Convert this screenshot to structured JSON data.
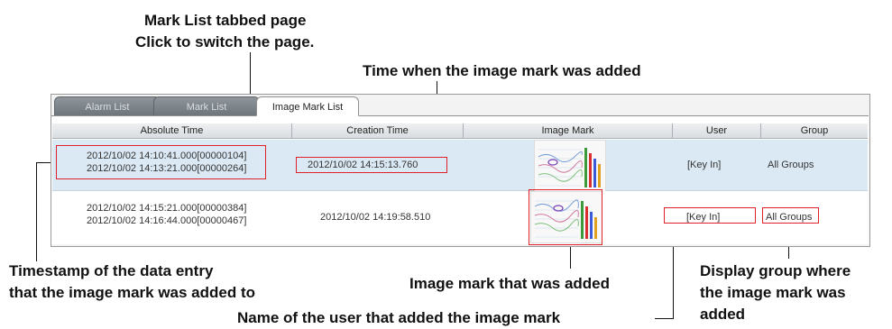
{
  "callouts": {
    "tab_title": "Mark List tabbed page",
    "tab_sub": "Click to switch the page.",
    "creation_time": "Time when the image mark was added",
    "timestamp_line1": "Timestamp of the data entry",
    "timestamp_line2": "that the image mark was added to",
    "image_mark": "Image mark that was added",
    "user": "Name of the user that added the image mark",
    "group_line1": "Display group where",
    "group_line2": "the image mark was",
    "group_line3": "added"
  },
  "tabs": [
    {
      "label": "Alarm List",
      "active": false
    },
    {
      "label": "Mark List",
      "active": false
    },
    {
      "label": "Image Mark List",
      "active": true
    }
  ],
  "table": {
    "headers": [
      "Absolute Time",
      "Creation Time",
      "Image Mark",
      "User",
      "Group"
    ],
    "rows": [
      {
        "absolute_time": [
          "2012/10/02 14:10:41.000[00000104]",
          "2012/10/02 14:13:21.000[00000264]"
        ],
        "creation_time": "2012/10/02 14:15:13.760",
        "user": "[Key In]",
        "group": "All Groups",
        "selected": true
      },
      {
        "absolute_time": [
          "2012/10/02 14:15:21.000[00000384]",
          "2012/10/02 14:16:44.000[00000467]"
        ],
        "creation_time": "2012/10/02 14:19:58.510",
        "user": "[Key In]",
        "group": "All Groups",
        "selected": false
      }
    ]
  },
  "colors": {
    "highlight": "#e0202a",
    "selected_row": "#dbe9f4",
    "tab_inactive": "#7b8288"
  }
}
